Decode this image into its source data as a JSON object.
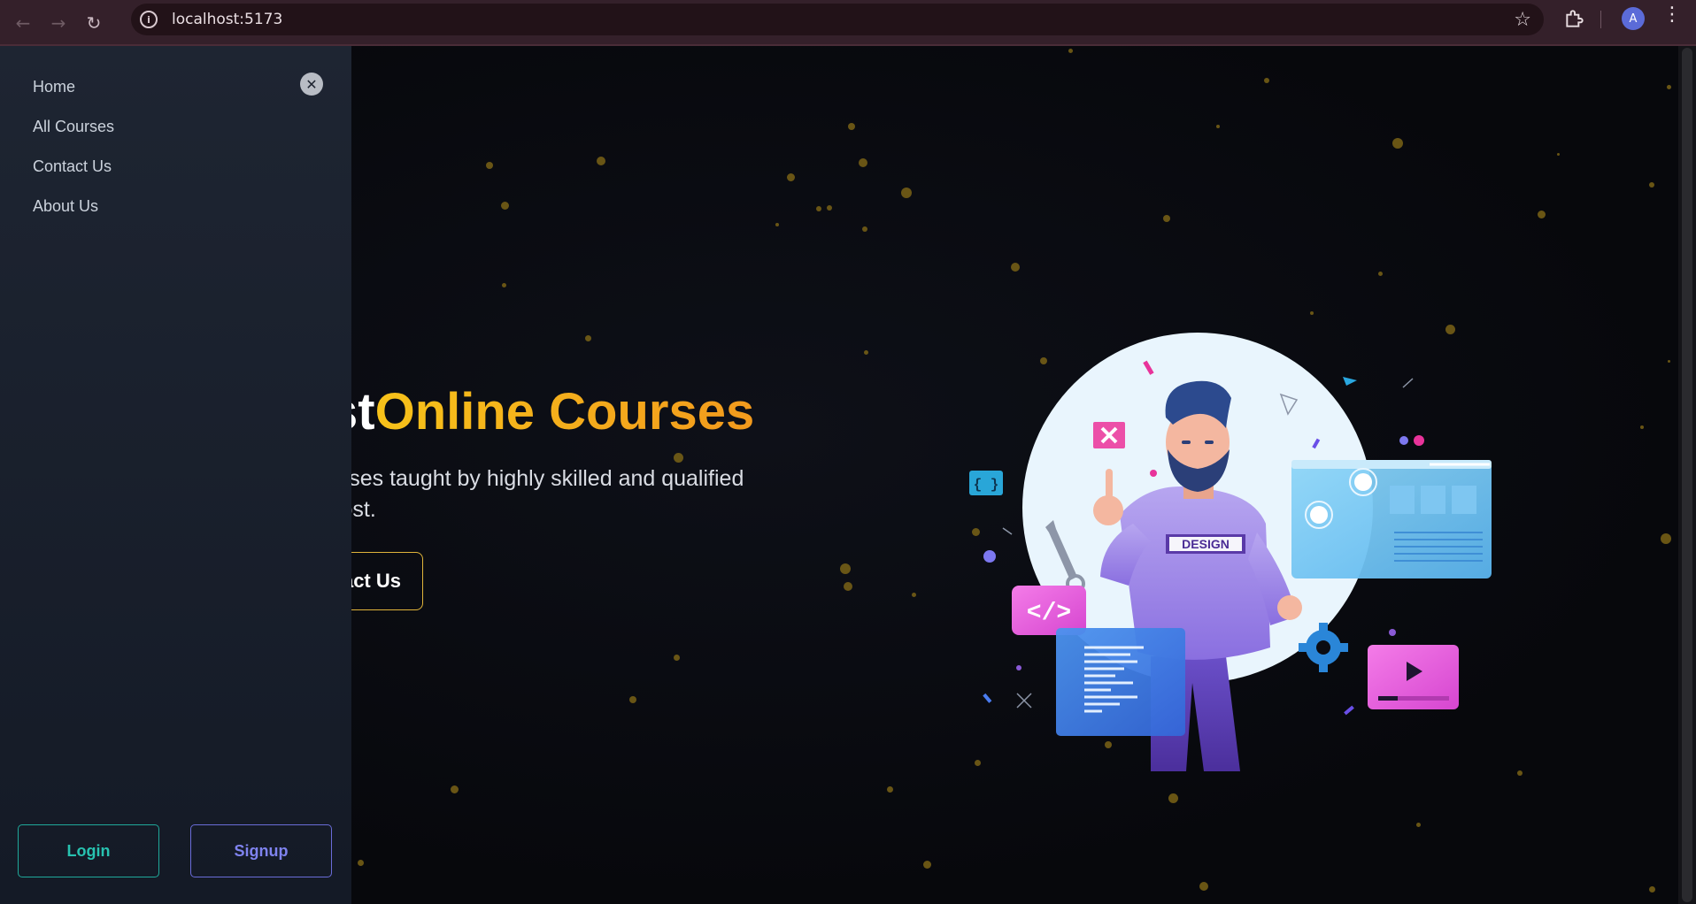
{
  "browser": {
    "url": "localhost:5173",
    "profile_initial": "A",
    "icons": [
      "back-arrow-icon",
      "forward-arrow-icon",
      "reload-icon",
      "site-info-icon",
      "bookmark-star-icon",
      "extensions-puzzle-icon",
      "menu-kebab-icon"
    ]
  },
  "sidebar": {
    "items": [
      {
        "label": "Home"
      },
      {
        "label": "All Courses"
      },
      {
        "label": "Contact Us"
      },
      {
        "label": "About Us"
      }
    ],
    "login_label": "Login",
    "signup_label": "Signup"
  },
  "hero": {
    "title_prefix": "st",
    "title_accent": "Online Courses",
    "description_line1": "urses taught by highly skilled and qualified",
    "description_line2": "cost.",
    "cta_label": "act Us",
    "illustration": {
      "badge_text": "DESIGN",
      "icons": [
        "close-icon",
        "code-icon",
        "braces-icon",
        "play-icon",
        "gear-icon",
        "wrench-icon"
      ]
    }
  },
  "colors": {
    "accent_start": "#f7c21a",
    "accent_end": "#f29a1d",
    "login": "#27c2b0",
    "signup": "#7f83ef",
    "cta_border": "#e0b43a"
  }
}
